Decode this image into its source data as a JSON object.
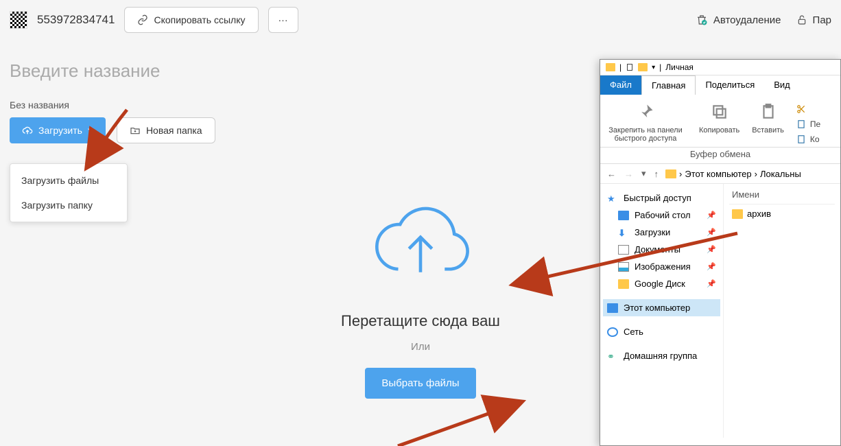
{
  "topbar": {
    "doc_id": "553972834741",
    "copy_link": "Скопировать ссылку",
    "dots": "···",
    "autodelete": "Автоудаление",
    "password": "Пар"
  },
  "title_placeholder": "Введите название",
  "subtitle": "Без названия",
  "actions": {
    "upload": "Загрузить",
    "new_folder": "Новая папка"
  },
  "upload_menu": {
    "files": "Загрузить файлы",
    "folder": "Загрузить папку"
  },
  "dropzone": {
    "title": "Перетащите сюда ваш",
    "or": "Или",
    "choose": "Выбрать файлы"
  },
  "explorer": {
    "window_title": "Личная",
    "tabs": {
      "file": "Файл",
      "home": "Главная",
      "share": "Поделиться",
      "view": "Вид"
    },
    "ribbon": {
      "pin": "Закрепить на панели быстрого доступа",
      "copy": "Копировать",
      "paste": "Вставить",
      "clipboard": "Буфер обмена",
      "side1": "Пе",
      "side2": "Ко"
    },
    "nav": {
      "this_pc": "Этот компьютер",
      "local": "Локальны"
    },
    "tree": {
      "quick": "Быстрый доступ",
      "desktop": "Рабочий стол",
      "downloads": "Загрузки",
      "documents": "Документы",
      "pictures": "Изображения",
      "gdrive": "Google Диск",
      "this_pc": "Этот компьютер",
      "network": "Сеть",
      "homegroup": "Домашняя группа"
    },
    "files": {
      "col_name": "Имени",
      "item1": "архив"
    }
  }
}
